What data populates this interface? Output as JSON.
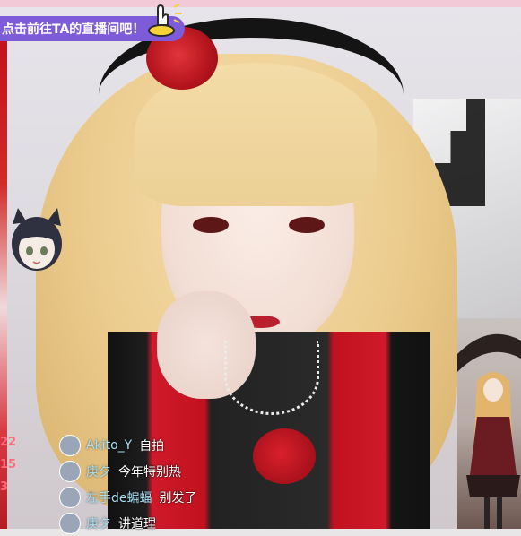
{
  "banner": {
    "text": "点击前往TA的直播间吧！",
    "background": "#7e5bd9",
    "icon": "hand-pointer-icon"
  },
  "side_numbers": [
    "22",
    "15",
    "3"
  ],
  "chat": {
    "messages": [
      {
        "user": "Akito_Y",
        "text": "自拍",
        "avatar": "user-avatar-icon"
      },
      {
        "user": "庚夕",
        "text": "今年特别热",
        "avatar": "user-avatar-icon"
      },
      {
        "user": "左手de蝙蝠",
        "text": "别发了",
        "avatar": "user-avatar-icon"
      },
      {
        "user": "庚夕",
        "text": "讲道理",
        "avatar": "user-avatar-icon"
      }
    ],
    "username_color": "#a8dff2",
    "message_color": "#ffffff"
  },
  "pip": {
    "label": ""
  }
}
